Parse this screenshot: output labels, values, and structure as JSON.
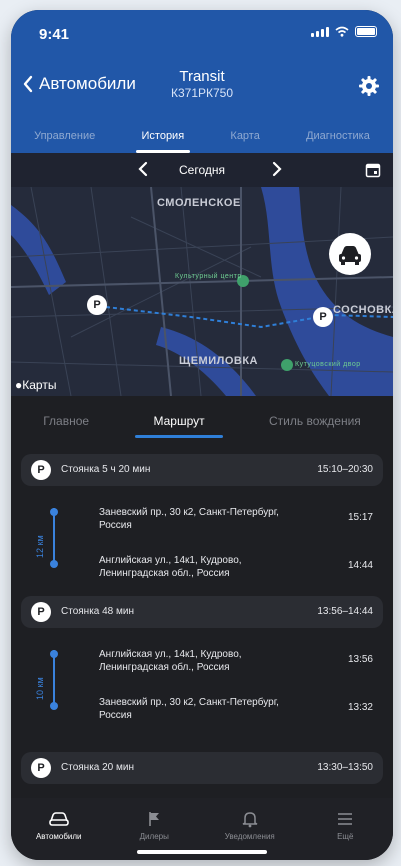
{
  "status": {
    "time": "9:41"
  },
  "nav": {
    "back_label": "Автомобили",
    "title": "Transit",
    "subtitle": "К371РК750"
  },
  "top_tabs": [
    {
      "label": "Управление",
      "active": false
    },
    {
      "label": "История",
      "active": true
    },
    {
      "label": "Карта",
      "active": false
    },
    {
      "label": "Диагностика",
      "active": false
    }
  ],
  "date": {
    "label": "Сегодня"
  },
  "map": {
    "labels": {
      "smolenskoe": "СМОЛЕНСКОЕ",
      "sosnovka": "СОСНОВКА",
      "shchemilovka": "ЩЕМИЛОВКА",
      "poi": "Культурный центр",
      "poi2": "Кутуцовский двор"
    },
    "pin_label": "P",
    "attribution": "Карты"
  },
  "sub_tabs": [
    {
      "label": "Главное",
      "active": false
    },
    {
      "label": "Маршрут",
      "active": true
    },
    {
      "label": "Стиль вождения",
      "active": false
    }
  ],
  "stops": [
    {
      "label": "Стоянка 5 ч 20 мин",
      "time": "15:10–20:30"
    },
    {
      "label": "Стоянка 48 мин",
      "time": "13:56–14:44"
    },
    {
      "label": "Стоянка 20 мин",
      "time": "13:30–13:50"
    }
  ],
  "routes": [
    {
      "distance": "12 км",
      "from": {
        "address": "Заневский пр., 30 к2, Санкт-Петербург, Россия",
        "time": "15:17"
      },
      "to": {
        "address": "Английская ул., 14к1, Кудрово, Ленинградская обл., Россия",
        "time": "14:44"
      }
    },
    {
      "distance": "10 км",
      "from": {
        "address": "Английская ул., 14к1, Кудрово, Ленинградская обл., Россия",
        "time": "13:56"
      },
      "to": {
        "address": "Заневский пр., 30 к2, Санкт-Петербург, Россия",
        "time": "13:32"
      }
    }
  ],
  "tabbar": [
    {
      "label": "Автомобили",
      "icon": "car-icon",
      "active": true
    },
    {
      "label": "Дилеры",
      "icon": "flag-icon",
      "active": false
    },
    {
      "label": "Уведомления",
      "icon": "bell-icon",
      "active": false
    },
    {
      "label": "Ещё",
      "icon": "menu-icon",
      "active": false
    }
  ],
  "colors": {
    "header": "#2157a8",
    "background": "#1e1f23",
    "accent": "#2f7fd8",
    "route_line": "#3a82dd"
  }
}
